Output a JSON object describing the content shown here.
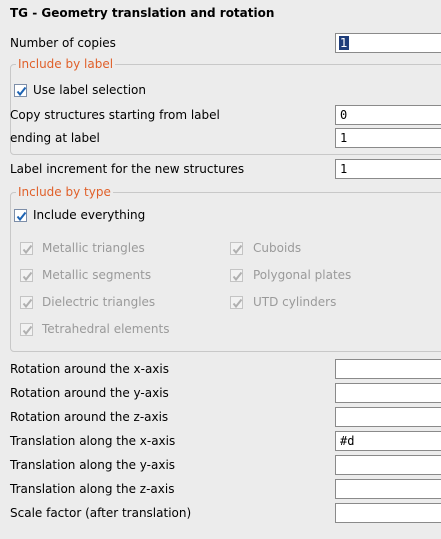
{
  "title": "TG - Geometry translation and rotation",
  "copies": {
    "label": "Number of copies",
    "value": "1"
  },
  "include_by_label": {
    "legend": "Include by label",
    "use_label_selection": {
      "label": "Use label selection",
      "checked": true
    },
    "start_label": {
      "label": "Copy structures starting from label",
      "value": "0"
    },
    "end_label": {
      "label": "ending at label",
      "value": "1"
    }
  },
  "label_increment": {
    "label": "Label increment for the new structures",
    "value": "1"
  },
  "include_by_type": {
    "legend": "Include by type",
    "include_everything": {
      "label": "Include everything",
      "checked": true
    },
    "types": [
      {
        "label": "Metallic triangles",
        "checked": true
      },
      {
        "label": "Cuboids",
        "checked": true
      },
      {
        "label": "Metallic segments",
        "checked": true
      },
      {
        "label": "Polygonal plates",
        "checked": true
      },
      {
        "label": "Dielectric triangles",
        "checked": true
      },
      {
        "label": "UTD cylinders",
        "checked": true
      },
      {
        "label": "Tetrahedral elements",
        "checked": true
      }
    ]
  },
  "transform_fields": [
    {
      "label": "Rotation around the x-axis",
      "value": ""
    },
    {
      "label": "Rotation around the y-axis",
      "value": ""
    },
    {
      "label": "Rotation around the z-axis",
      "value": ""
    },
    {
      "label": "Translation along the x-axis",
      "value": "#d"
    },
    {
      "label": "Translation along the y-axis",
      "value": ""
    },
    {
      "label": "Translation along the z-axis",
      "value": ""
    },
    {
      "label": "Scale factor (after translation)",
      "value": ""
    }
  ],
  "colors": {
    "legend": "#e0602a",
    "checkmark": "#1e64b4",
    "selection": "#1f3d7a"
  }
}
